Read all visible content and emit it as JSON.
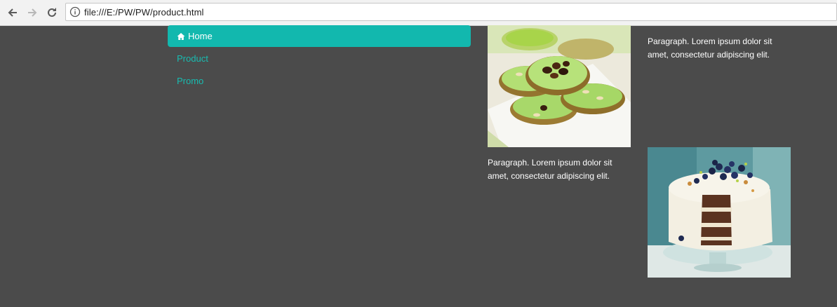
{
  "browser": {
    "url": "file:///E:/PW/PW/product.html"
  },
  "nav": {
    "items": [
      {
        "label": "Home",
        "active": true
      },
      {
        "label": "Product",
        "active": false
      },
      {
        "label": "Promo",
        "active": false
      }
    ]
  },
  "content": {
    "paragraph_1": "Paragraph. Lorem ipsum dolor sit amet, consectetur adipiscing elit.",
    "paragraph_2": "Paragraph. Lorem ipsum dolor sit amet, consectetur adipiscing elit."
  },
  "colors": {
    "background": "#4b4b4b",
    "accent": "#12b8ae",
    "link": "#18bcb1"
  }
}
